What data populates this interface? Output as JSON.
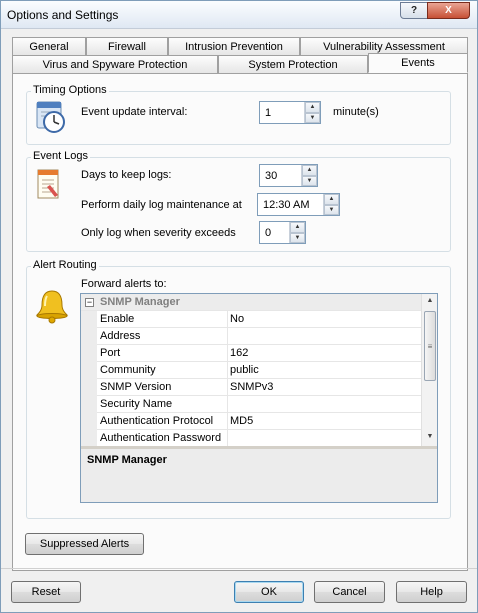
{
  "window": {
    "title": "Options and Settings",
    "help_glyph": "?",
    "close_glyph": "X"
  },
  "tabs": {
    "row1": [
      "General",
      "Firewall",
      "Intrusion Prevention",
      "Vulnerability Assessment"
    ],
    "row2": [
      "Virus and Spyware Protection",
      "System Protection",
      "Events"
    ],
    "active": "Events"
  },
  "timing": {
    "group_label": "Timing Options",
    "interval_label": "Event update interval:",
    "interval_value": "1",
    "interval_unit": "minute(s)"
  },
  "event_logs": {
    "group_label": "Event Logs",
    "days_label": "Days to keep logs:",
    "days_value": "30",
    "maintenance_label": "Perform daily log maintenance at",
    "maintenance_value": "12:30 AM",
    "severity_label": "Only log when severity exceeds",
    "severity_value": "0"
  },
  "alert_routing": {
    "group_label": "Alert Routing",
    "forward_label": "Forward alerts to:",
    "category": "SNMP Manager",
    "expander": "−",
    "properties": [
      {
        "name": "Enable",
        "value": "No"
      },
      {
        "name": "Address",
        "value": ""
      },
      {
        "name": "Port",
        "value": "162"
      },
      {
        "name": "Community",
        "value": "public"
      },
      {
        "name": "SNMP Version",
        "value": "SNMPv3"
      },
      {
        "name": "Security Name",
        "value": ""
      },
      {
        "name": "Authentication Protocol",
        "value": "MD5"
      },
      {
        "name": "Authentication Password",
        "value": ""
      }
    ],
    "description_title": "SNMP Manager"
  },
  "buttons": {
    "suppressed": "Suppressed Alerts",
    "reset": "Reset",
    "ok": "OK",
    "cancel": "Cancel",
    "help": "Help"
  },
  "icons": {
    "timing": "clock-calendar-icon",
    "logs": "log-notepad-icon",
    "alerts": "bell-icon"
  },
  "colors": {
    "panel": "#fbfbfb",
    "window": "#f0f0f0",
    "border": "#7f9db9",
    "bell": "#e8b400"
  }
}
